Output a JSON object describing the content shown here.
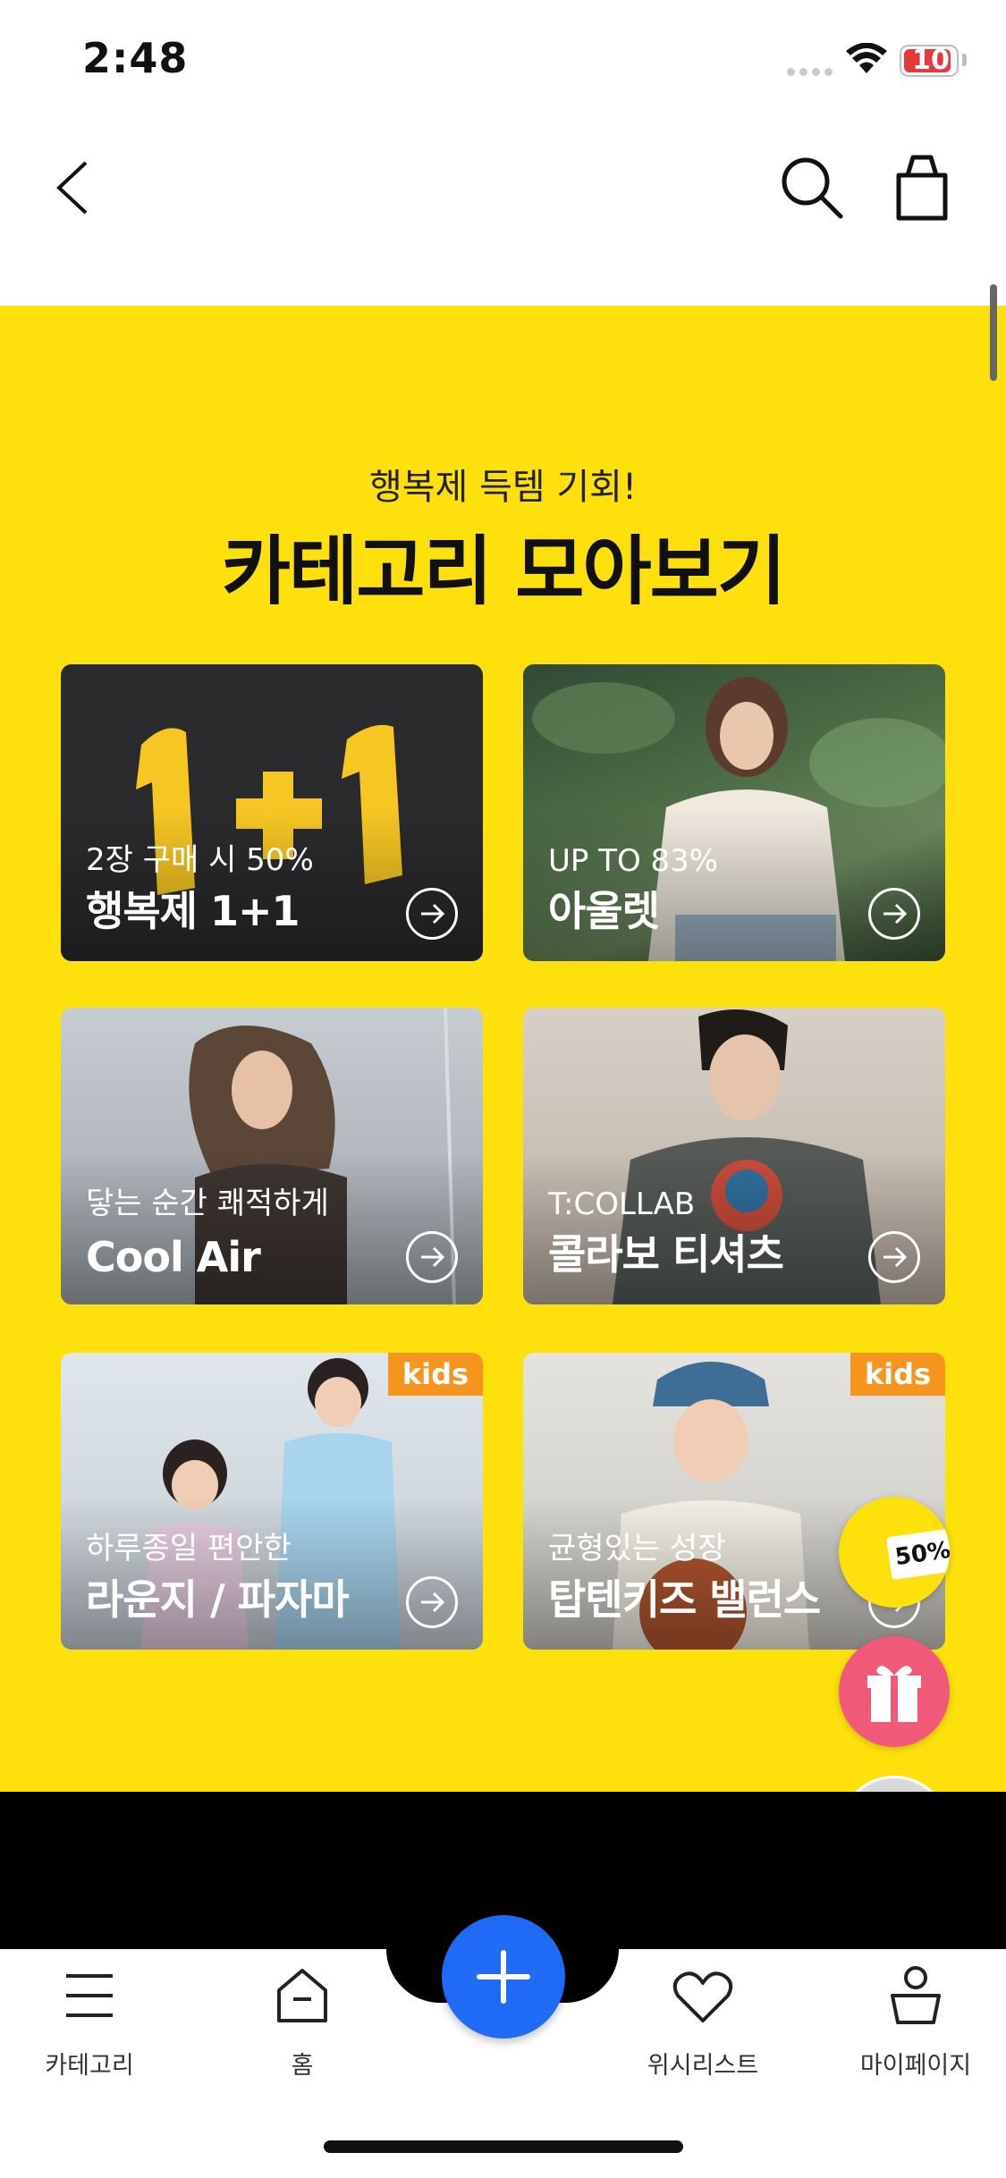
{
  "status_bar": {
    "time": "2:48",
    "battery": "10"
  },
  "banner": {
    "subtitle": "행복제 득템 기회!",
    "title": "카테고리 모아보기"
  },
  "cards": [
    {
      "sub": "2장 구매 시 50%",
      "title": "행복제 1+1",
      "badge": ""
    },
    {
      "sub": "UP TO 83%",
      "title": "아울렛",
      "badge": ""
    },
    {
      "sub": "닿는 순간 쾌적하게",
      "title": "Cool Air",
      "badge": ""
    },
    {
      "sub": "T:COLLAB",
      "title": "콜라보 티셔츠",
      "badge": ""
    },
    {
      "sub": "하루종일 편안한",
      "title": "라운지 / 파자마",
      "badge": "kids"
    },
    {
      "sub": "균형있는 성장",
      "title": "탑텐키즈 밸런스",
      "badge": "kids"
    }
  ],
  "float": {
    "coupon": "50%"
  },
  "tabbar": {
    "items": [
      {
        "label": "카테고리"
      },
      {
        "label": "홈"
      },
      {
        "label": "위시리스트"
      },
      {
        "label": "마이페이지"
      }
    ]
  },
  "colors": {
    "banner_yellow": "#fde00c",
    "fab_blue": "#1f6bf5",
    "gift_pink": "#f05a78",
    "kids_orange": "#f7941d"
  }
}
